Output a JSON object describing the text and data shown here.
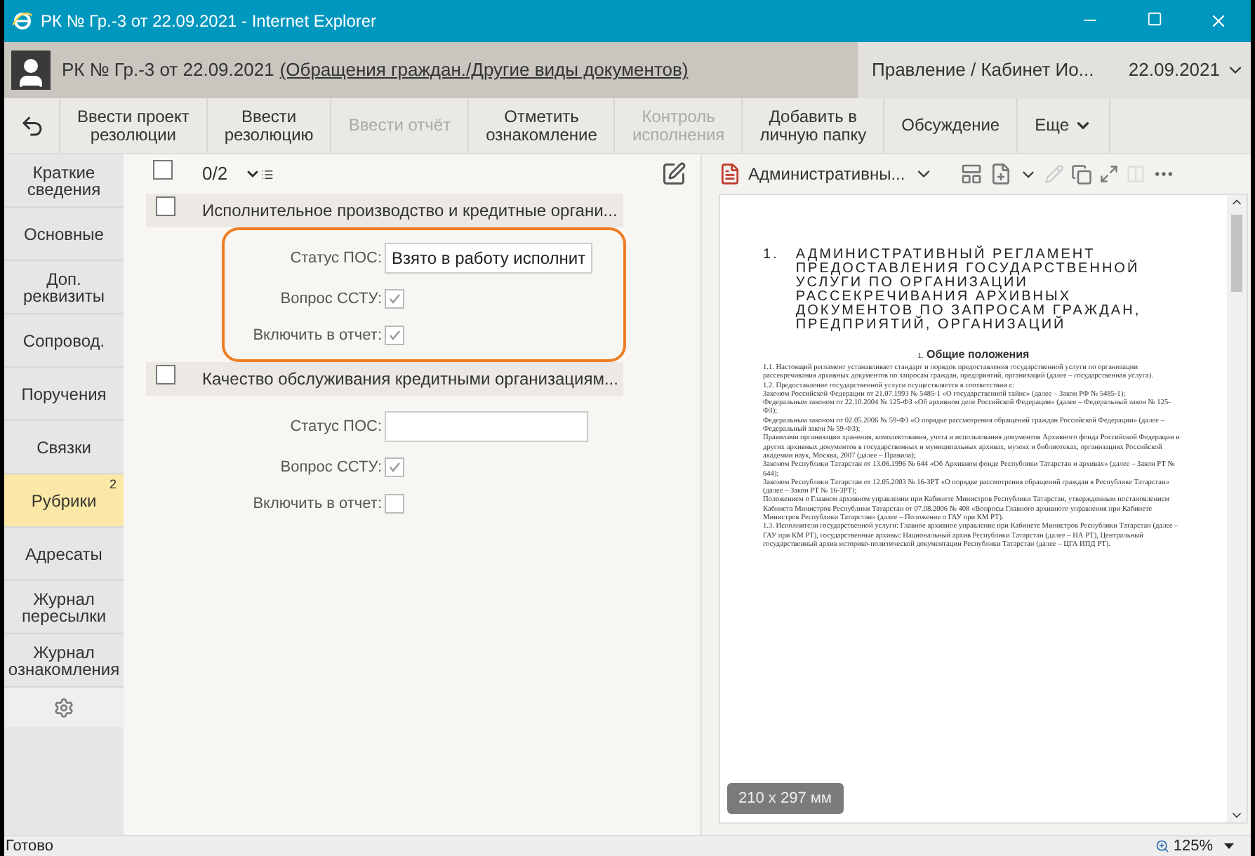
{
  "window": {
    "title": "РК № Гр.-3 от 22.09.2021 - Internet Explorer"
  },
  "header": {
    "title": "РК № Гр.-3 от 22.09.2021",
    "category_link": "(Обращения граждан./Другие виды документов)",
    "department": "Правление / Кабинет Ио...",
    "date": "22.09.2021"
  },
  "toolbar": [
    {
      "label": "Ввести проект\nрезолюции",
      "disabled": false,
      "kind": "button"
    },
    {
      "label": "Ввести\nрезолюцию",
      "disabled": false,
      "kind": "button"
    },
    {
      "label": "Ввести отчёт",
      "disabled": true,
      "kind": "button"
    },
    {
      "label": "Отметить\nознакомление",
      "disabled": false,
      "kind": "button"
    },
    {
      "label": "Контроль\nисполнения",
      "disabled": true,
      "kind": "button"
    },
    {
      "label": "Добавить в\nличную папку",
      "disabled": false,
      "kind": "button"
    },
    {
      "label": "Обсуждение",
      "disabled": false,
      "kind": "button"
    },
    {
      "label": "Еще",
      "disabled": false,
      "kind": "menu"
    }
  ],
  "sidebar": {
    "items": [
      {
        "label": "Краткие\nсведения",
        "selected": false
      },
      {
        "label": "Основные",
        "selected": false
      },
      {
        "label": "Доп.\nреквизиты",
        "selected": false
      },
      {
        "label": "Сопровод.",
        "selected": false
      },
      {
        "label": "Поручения",
        "selected": false
      },
      {
        "label": "Связки",
        "selected": false
      },
      {
        "label": "Рубрики",
        "selected": true,
        "badge": "2"
      },
      {
        "label": "Адресаты",
        "selected": false
      },
      {
        "label": "Журнал\nпересылки",
        "selected": false
      },
      {
        "label": "Журнал\nознакомления",
        "selected": false
      }
    ]
  },
  "list": {
    "checked": false,
    "counter": "0/2",
    "groups": [
      {
        "title": "Исполнительное производство и кредитные органи...",
        "checked": false,
        "highlighted": true,
        "fields": [
          {
            "kind": "text",
            "label": "Статус ПОС:",
            "value": "Взято в работу исполнит"
          },
          {
            "kind": "checkbox",
            "label": "Вопрос ССТУ:",
            "checked": true
          },
          {
            "kind": "checkbox",
            "label": "Включить в отчет:",
            "checked": true
          }
        ]
      },
      {
        "title": "Качество обслуживания кредитными организациям...",
        "checked": false,
        "highlighted": false,
        "fields": [
          {
            "kind": "text",
            "label": "Статус ПОС:"
          },
          {
            "kind": "checkbox",
            "label": "Вопрос ССТУ:",
            "checked": true
          },
          {
            "kind": "checkbox",
            "label": "Включить в отчет:",
            "checked": false
          }
        ]
      }
    ]
  },
  "viewer": {
    "document_name": "Административны...",
    "heading_number": "1.",
    "heading_lines": [
      "АДМИНИСТРАТИВНЫЙ РЕГЛАМЕНТ",
      "ПРЕДОСТАВЛЕНИЯ ГОСУДАРСТВЕННОЙ",
      "УСЛУГИ ПО ОРГАНИЗАЦИИ",
      "РАССЕКРЕЧИВАНИЯ АРХИВНЫХ",
      "ДОКУМЕНТОВ ПО ЗАПРОСАМ ГРАЖДАН,",
      "ПРЕДПРИЯТИЙ, ОРГАНИЗАЦИЙ"
    ],
    "section_number": "1.",
    "section_title": "Общие положения",
    "paragraphs": [
      "1.1. Настоящий регламент устанавливает стандарт и порядок предоставления государственной услуги по организации рассекречивания архивных документов по запросам граждан, предприятий, организаций (далее – государственная услуга).",
      "1.2. Предоставление государственной услуги осуществляется в соответствии с:",
      "Законом Российской Федерации от 21.07.1993 № 5485-1 «О государственной тайне» (далее – Закон РФ № 5485-1);",
      "Федеральным законом от 22.10.2004 № 125-ФЗ «Об архивном деле Российской Федерации» (далее – Федеральный закон № 125-ФЗ);",
      "Федеральным законом от 02.05.2006 № 59-ФЗ «О порядке рассмотрения обращений граждан Российской Федерации» (далее – Федеральный закон № 59-ФЗ);",
      "Правилами организации хранения, комплектования, учета и использования документов Архивного фонда Российской Федерации и других архивных документов в государственных и муниципальных архивах, музеях и библиотеках, организациях Российской академии наук, Москва, 2007 (далее – Правила);",
      "Законом Республики Татарстан от 13.06.1996 № 644 «Об Архивном фонде Республики Татарстан и архивах» (далее – Закон РТ № 644);",
      "Законом Республики Татарстан от 12.05.2003 № 16-ЗРТ «О порядке рассмотрения обращений граждан в Республике Татарстан» (далее – Закон РТ № 16-ЗРТ);",
      "Положением о Главном архивном управлении при Кабинете Министров Республики Татарстан, утвержденным постановлением Кабинета Министров Республики Татарстан от 07.08.2006 № 408 «Вопросы Главного архивного управления при Кабинете Министров Республики Татарстан» (далее – Положение о ГАУ при КМ РТ).",
      "1.3. Исполнители государственной услуги: Главное архивное управление при Кабинете Министров Республики Татарстан (далее – ГАУ при КМ РТ), государственные архивы: Национальный архив Республики Татарстан (далее – НА РТ), Центральный государственный архив историко-политической документации Республики Татарстан (далее – ЦГА ИПД РТ)."
    ],
    "page_size": "210 x 297 мм"
  },
  "status_bar": {
    "text": "Готово",
    "zoom": "125%"
  }
}
